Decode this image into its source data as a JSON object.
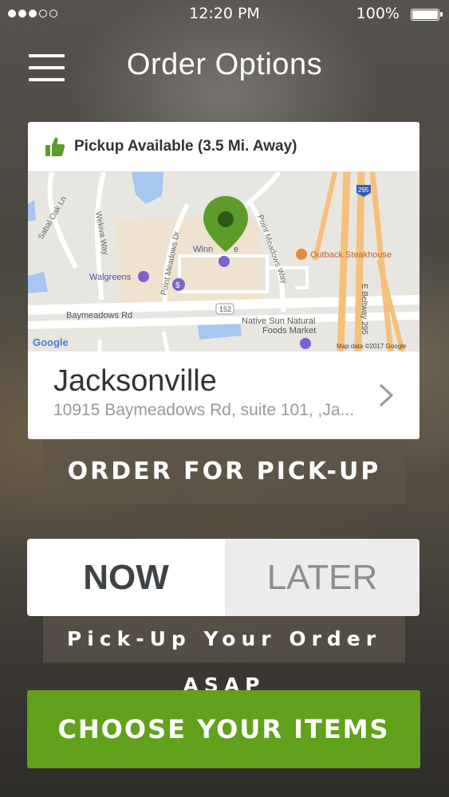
{
  "status_bar": {
    "time": "12:20 PM",
    "battery": "100%",
    "signal_bars": 5,
    "signal_filled": 3
  },
  "header": {
    "title": "Order Options"
  },
  "location_card": {
    "availability": "Pickup Available (3.5 Mi. Away)",
    "map": {
      "labels": {
        "sabal": "Sabal Oak Ln",
        "wekiva": "Wekiva Way",
        "walgreens": "Walgreens",
        "point_meadows_dr": "Point Meadows Dr",
        "winn": "Winn",
        "dixie": "e",
        "point_meadows_way": "Point Meadows Way",
        "outback": "Outback Steakhouse",
        "baymeadows": "Baymeadows Rd",
        "route152": "152",
        "native_sun_1": "Native Sun Natural",
        "native_sun_2": "Foods Market",
        "beltway": "E Beltway 295",
        "route295": "295",
        "google": "Google",
        "attribution": "Map data ©2017 Google"
      }
    },
    "name": "Jacksonville",
    "address": "10915 Baymeadows Rd, suite 101, ,Ja..."
  },
  "order_type_button": "ORDER FOR PICK-UP",
  "timing": {
    "now": "NOW",
    "later": "LATER",
    "selected": "NOW"
  },
  "timing_note": "Pick-Up Your Order ASAP",
  "cta": "CHOOSE YOUR ITEMS",
  "colors": {
    "accent_green": "#62a11b",
    "pin_green": "#5d9c2a",
    "map_water": "#a5c7f0",
    "highway": "#f4c17c"
  }
}
